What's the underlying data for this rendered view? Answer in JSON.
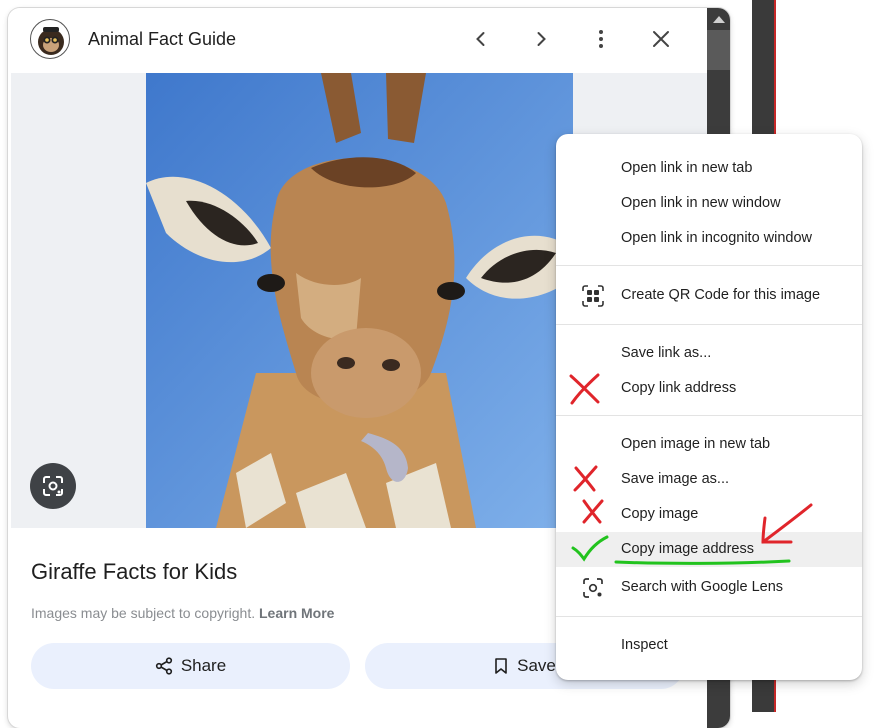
{
  "panel": {
    "title": "Animal Fact Guide",
    "icons": {
      "back": "chevron-left-icon",
      "forward": "chevron-right-icon",
      "more": "more-vert-icon",
      "close": "close-icon"
    }
  },
  "result": {
    "title": "Giraffe Facts for Kids",
    "copyright_text": "Images may be subject to copyright.",
    "learn_more": "Learn More",
    "share_label": "Share",
    "save_label": "Save"
  },
  "context_menu": {
    "items": [
      {
        "label": "Open link in new tab"
      },
      {
        "label": "Open link in new window"
      },
      {
        "label": "Open link in incognito window"
      },
      {
        "label": "Create QR Code for this image",
        "icon": "qr-code-icon"
      },
      {
        "label": "Save link as..."
      },
      {
        "label": "Copy link address",
        "mark": "red-x"
      },
      {
        "label": "Open image in new tab"
      },
      {
        "label": "Save image as...",
        "mark": "red-x"
      },
      {
        "label": "Copy image",
        "mark": "red-x"
      },
      {
        "label": "Copy image address",
        "mark": "green-check",
        "highlighted": true
      },
      {
        "label": "Search with Google Lens",
        "icon": "lens-icon"
      },
      {
        "label": "Inspect"
      }
    ]
  },
  "colors": {
    "annotation_red": "#e0252b",
    "annotation_green": "#22c31e",
    "pill_bg": "#eaf0fd",
    "sky_blue": "#5b8fd6"
  }
}
